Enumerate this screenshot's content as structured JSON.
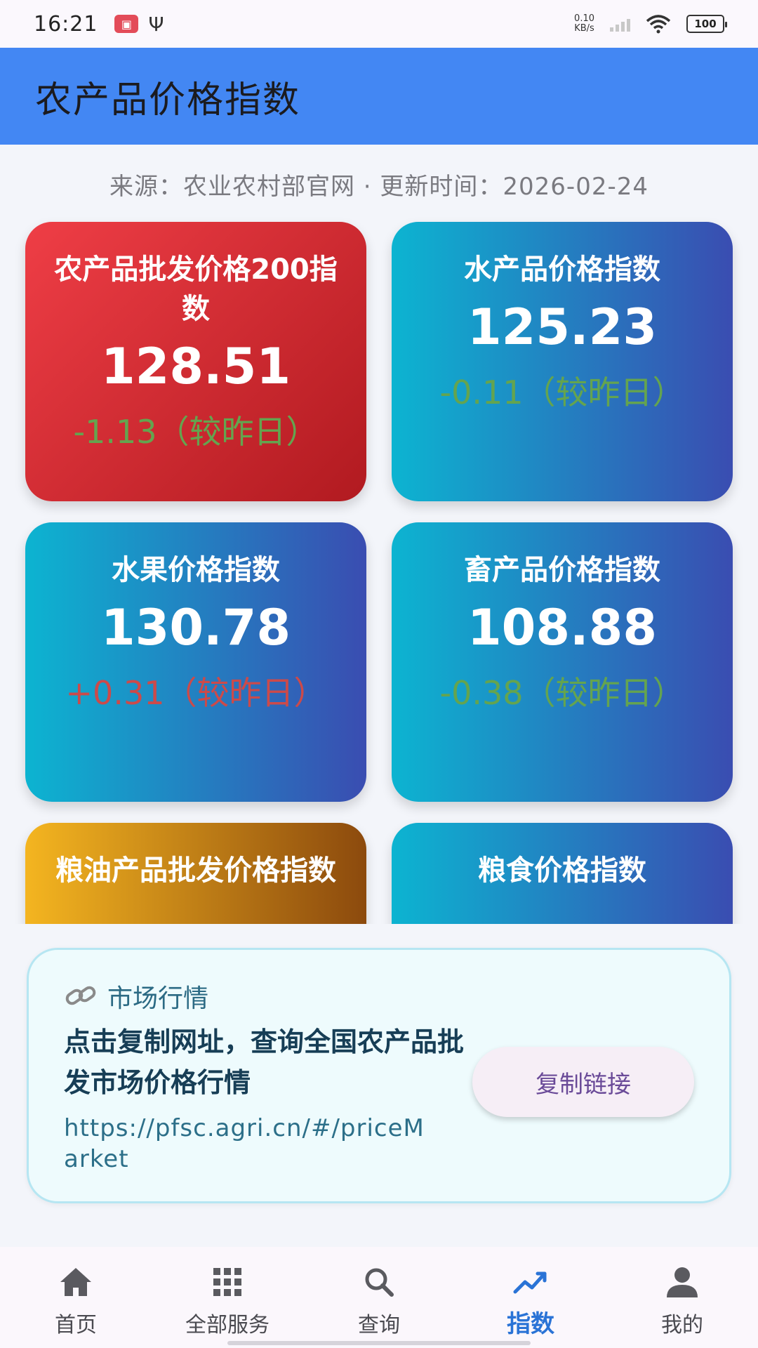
{
  "status_bar": {
    "time": "16:21",
    "notif_icon": "app-notification-icon",
    "usb_icon": "usb-icon",
    "net_speed_value": "0.10",
    "net_speed_unit": "KB/s",
    "battery": "100"
  },
  "header": {
    "title": "农产品价格指数"
  },
  "source_line": "来源：农业农村部官网 · 更新时间：2026-02-24",
  "cards": [
    {
      "title": "农产品批发价格200指数",
      "value": "128.51",
      "change": "-1.13（较昨日）"
    },
    {
      "title": "水产品价格指数",
      "value": "125.23",
      "change": "-0.11（较昨日）"
    },
    {
      "title": "水果价格指数",
      "value": "130.78",
      "change": "+0.31（较昨日）"
    },
    {
      "title": "畜产品价格指数",
      "value": "108.88",
      "change": "-0.38（较昨日）"
    },
    {
      "title": "粮油产品批发价格指数"
    },
    {
      "title": "粮食价格指数"
    }
  ],
  "market": {
    "label": "市场行情",
    "description": "点击复制网址，查询全国农产品批发市场价格行情",
    "url": "https://pfsc.agri.cn/#/priceMarket",
    "copy_label": "复制链接"
  },
  "nav": [
    {
      "label": "首页",
      "icon": "home-icon"
    },
    {
      "label": "全部服务",
      "icon": "grid-icon"
    },
    {
      "label": "查询",
      "icon": "search-icon"
    },
    {
      "label": "指数",
      "icon": "trend-icon"
    },
    {
      "label": "我的",
      "icon": "user-icon"
    }
  ],
  "colors": {
    "header": "#4387f3",
    "card_red": "#ef3e46",
    "card_blue": "#0cb4d1",
    "card_gold": "#f4b520",
    "change_down": "#64a44f",
    "change_up": "#cc4a4a",
    "nav_active": "#2a73d6"
  }
}
